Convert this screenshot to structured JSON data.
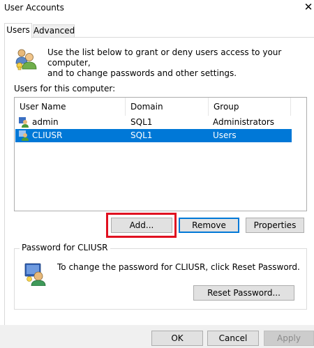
{
  "window": {
    "title": "User Accounts"
  },
  "tabs": [
    {
      "label": "Users",
      "active": true
    },
    {
      "label": "Advanced",
      "active": false
    }
  ],
  "intro": {
    "line1": "Use the list below to grant or deny users access to your computer,",
    "line2": "and to change passwords and other settings."
  },
  "users_list": {
    "label": "Users for this computer:",
    "columns": [
      "User Name",
      "Domain",
      "Group"
    ],
    "rows": [
      {
        "user": "admin",
        "domain": "SQL1",
        "group": "Administrators",
        "selected": false
      },
      {
        "user": "CLIUSR",
        "domain": "SQL1",
        "group": "Users",
        "selected": true
      }
    ]
  },
  "list_buttons": {
    "add": "Add...",
    "remove": "Remove",
    "properties": "Properties"
  },
  "password_group": {
    "label": "Password for CLIUSR",
    "text": "To change the password for CLIUSR, click Reset Password.",
    "reset_button": "Reset Password..."
  },
  "footer_buttons": {
    "ok": "OK",
    "cancel": "Cancel",
    "apply": "Apply"
  },
  "colors": {
    "selection": "#0078d7",
    "highlight": "#e01020",
    "default_button_border": "#0078d7"
  },
  "icons": [
    "users-icon",
    "user-icon",
    "password-user-icon",
    "close-icon"
  ]
}
